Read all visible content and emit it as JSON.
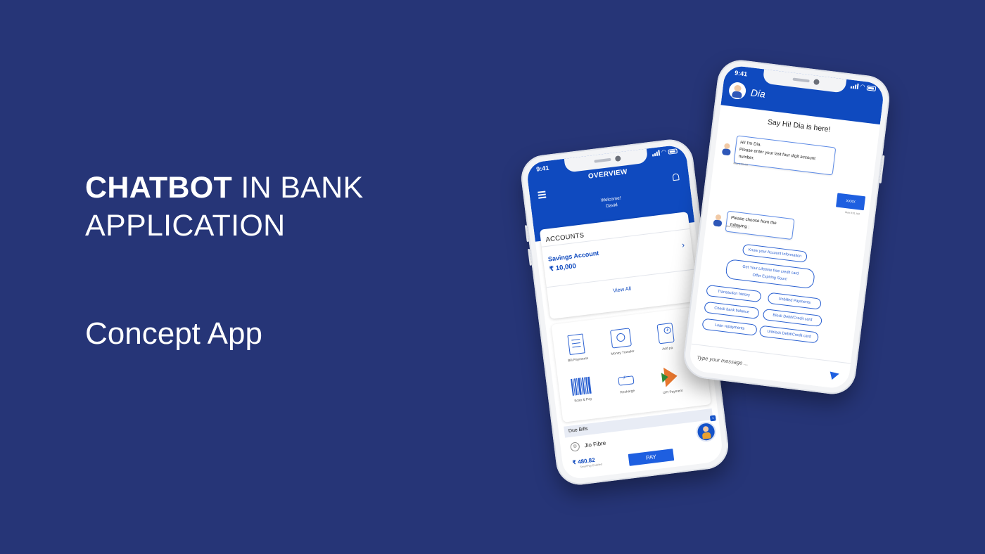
{
  "headline": {
    "word_strong": "CHATBOT",
    "rest_line1": " IN BANK",
    "line2": "APPLICATION"
  },
  "subtitle": "Concept App",
  "phone_banking": {
    "status_time": "9:41",
    "title": "OVERVIEW",
    "welcome_line1": "Welcome!",
    "welcome_line2": "David",
    "accounts_label": "ACCOUNTS",
    "account_name": "Savings Account",
    "account_balance": "₹  10,000",
    "view_all": "View All",
    "services": [
      {
        "label": "Bill Payments",
        "icon": "bill-icon"
      },
      {
        "label": "Money Transfer",
        "icon": "envelope-money-icon"
      },
      {
        "label": "Add pa",
        "icon": "add-payee-icon"
      },
      {
        "label": "Scan & Pay",
        "icon": "barcode-icon"
      },
      {
        "label": "Recharge",
        "icon": "battery-icon"
      },
      {
        "label": "UPI Payment",
        "icon": "upi-icon"
      }
    ],
    "due_bills_label": "Due Bills",
    "bill_name": "Jio Fibre",
    "bill_amount": "₹  480.82",
    "bill_sub": "SmartPay Enabled",
    "pay_label": "PAY",
    "badge": "1"
  },
  "phone_chat": {
    "status_time": "9:41",
    "bot_name": "Dia",
    "greeting": "Say Hi! Dia is here!",
    "msg1_line1": "Hi!  I'm Dia.",
    "msg1_line2": "Please enter your last four digit account number.",
    "msg1_time": "Mon 9:05 AM",
    "user_msg": "XXXX",
    "user_time": "Mon 9:01 AM",
    "msg2": "Please choose from the following :",
    "msg2_time": "Mon 9:01 AM",
    "options": {
      "know_account": "Know your Account Information",
      "credit_card_line1": "Get Your Lifetime free credit card",
      "credit_card_line2": "Offer Expiring Soon!",
      "transaction_history": "Transaction history",
      "unbilled_payments": "Unbilled Payments",
      "check_balance": "Check bank balance",
      "block_card": "Block  Debit/Credit card",
      "loan_repayments": "Loan repayments",
      "unblock_card": "Unblock  Debit/Credit card"
    },
    "input_placeholder": "Type your message ..."
  }
}
